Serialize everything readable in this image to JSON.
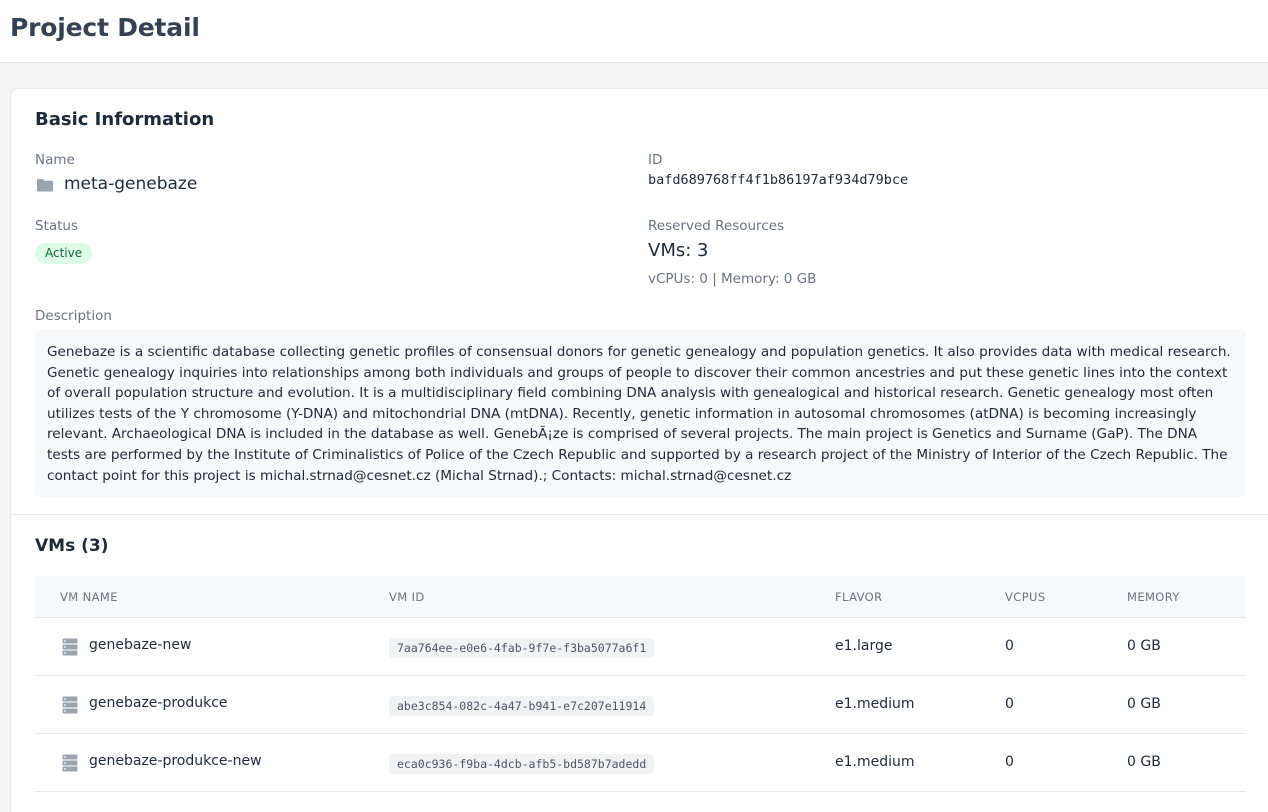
{
  "page": {
    "title": "Project Detail"
  },
  "basic_info": {
    "heading": "Basic Information",
    "name_label": "Name",
    "name_value": "meta-genebaze",
    "id_label": "ID",
    "id_value": "bafd689768ff4f1b86197af934d79bce",
    "status_label": "Status",
    "status_value": "Active",
    "reserved_label": "Reserved Resources",
    "reserved_vms": "VMs: 3",
    "reserved_detail": "vCPUs: 0 | Memory: 0 GB",
    "description_label": "Description",
    "description": "Genebaze is a scientific database collecting genetic profiles of consensual donors for genetic genealogy and population genetics. It also provides data with medical research. Genetic genealogy inquiries into relationships among both individuals and groups of people to discover their common ancestries and put these genetic lines into the context of overall population structure and evolution. It is a multidisciplinary field combining DNA analysis with genealogical and historical research. Genetic genealogy most often utilizes tests of the Y chromosome (Y-DNA) and mitochondrial DNA (mtDNA). Recently, genetic information in autosomal chromosomes (atDNA) is becoming increasingly relevant. Archaeological DNA is included in the database as well. GenebÃ¡ze is comprised of several projects. The main project is Genetics and Surname (GaP). The DNA tests are performed by the Institute of Criminalistics of Police of the Czech Republic and supported by a research project of the Ministry of Interior of the Czech Republic. The contact point for this project is michal.strnad@cesnet.cz (Michal Strnad).; Contacts: michal.strnad@cesnet.cz"
  },
  "vms": {
    "heading": "VMs (3)",
    "columns": [
      "VM NAME",
      "VM ID",
      "FLAVOR",
      "VCPUS",
      "MEMORY"
    ],
    "rows": [
      {
        "name": "genebaze-new",
        "id": "7aa764ee-e0e6-4fab-9f7e-f3ba5077a6f1",
        "flavor": "e1.large",
        "vcpus": "0",
        "memory": "0 GB"
      },
      {
        "name": "genebaze-produkce",
        "id": "abe3c854-082c-4a47-b941-e7c207e11914",
        "flavor": "e1.medium",
        "vcpus": "0",
        "memory": "0 GB"
      },
      {
        "name": "genebaze-produkce-new",
        "id": "eca0c936-f9ba-4dcb-afb5-bd587b7adedd",
        "flavor": "e1.medium",
        "vcpus": "0",
        "memory": "0 GB"
      }
    ]
  },
  "icons": {
    "folder": "folder-icon",
    "server": "server-icon"
  },
  "colors": {
    "status_bg": "#dcfce7",
    "status_text": "#166534"
  }
}
